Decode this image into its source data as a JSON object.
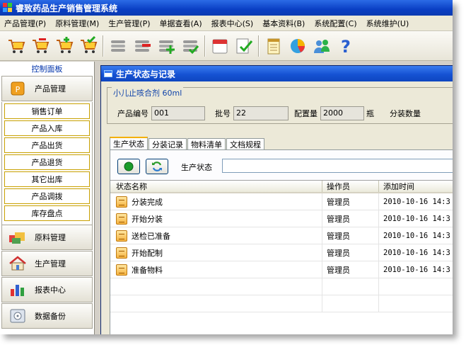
{
  "app": {
    "title": "睿致药品生产销售管理系统"
  },
  "menu": [
    "产品管理(P)",
    "原料管理(M)",
    "生产管理(P)",
    "单据查看(A)",
    "报表中心(S)",
    "基本资料(B)",
    "系统配置(C)",
    "系统维护(U)"
  ],
  "toolbar_icons": [
    "cart-icon",
    "cart-remove-icon",
    "cart-add-icon",
    "cart-check-icon",
    "list-icon",
    "list-remove-icon",
    "list-add-icon",
    "list-check-icon",
    "calendar-icon",
    "task-check-icon",
    "notepad-icon",
    "pie-chart-icon",
    "users-icon",
    "help-icon"
  ],
  "sidebar": {
    "title": "控制面板",
    "product_group": "产品管理",
    "product_items": [
      "销售订单",
      "产品入库",
      "产品出货",
      "产品退货",
      "其它出库",
      "产品调拨",
      "库存盘点"
    ],
    "groups": [
      "原料管理",
      "生产管理",
      "报表中心",
      "数据备份"
    ]
  },
  "window": {
    "title": "生产状态与记录",
    "product_name": "小儿止咳合剂 60ml",
    "fields": {
      "code_label": "产品编号",
      "code_value": "001",
      "batch_label": "批号",
      "batch_value": "22",
      "qty_label": "配置量",
      "qty_value": "2000",
      "qty_unit": "瓶",
      "pack_label": "分装数量"
    },
    "tabs": [
      "生产状态",
      "分装记录",
      "物料清单",
      "文档规程"
    ],
    "status_label": "生产状态",
    "columns": [
      "状态名称",
      "操作员",
      "添加时间"
    ],
    "rows": [
      {
        "name": "分装完成",
        "operator": "管理员",
        "time": "2010-10-16 14:3"
      },
      {
        "name": "开始分装",
        "operator": "管理员",
        "time": "2010-10-16 14:3"
      },
      {
        "name": "送检已准备",
        "operator": "管理员",
        "time": "2010-10-16 14:3"
      },
      {
        "name": "开始配制",
        "operator": "管理员",
        "time": "2010-10-16 14:3"
      },
      {
        "name": "准备物料",
        "operator": "管理员",
        "time": "2010-10-16 14:3"
      }
    ]
  },
  "colors": {
    "title_blue": "#0a3fc4",
    "tab_accent": "#f4b000",
    "sidebar_title": "#0033aa"
  }
}
